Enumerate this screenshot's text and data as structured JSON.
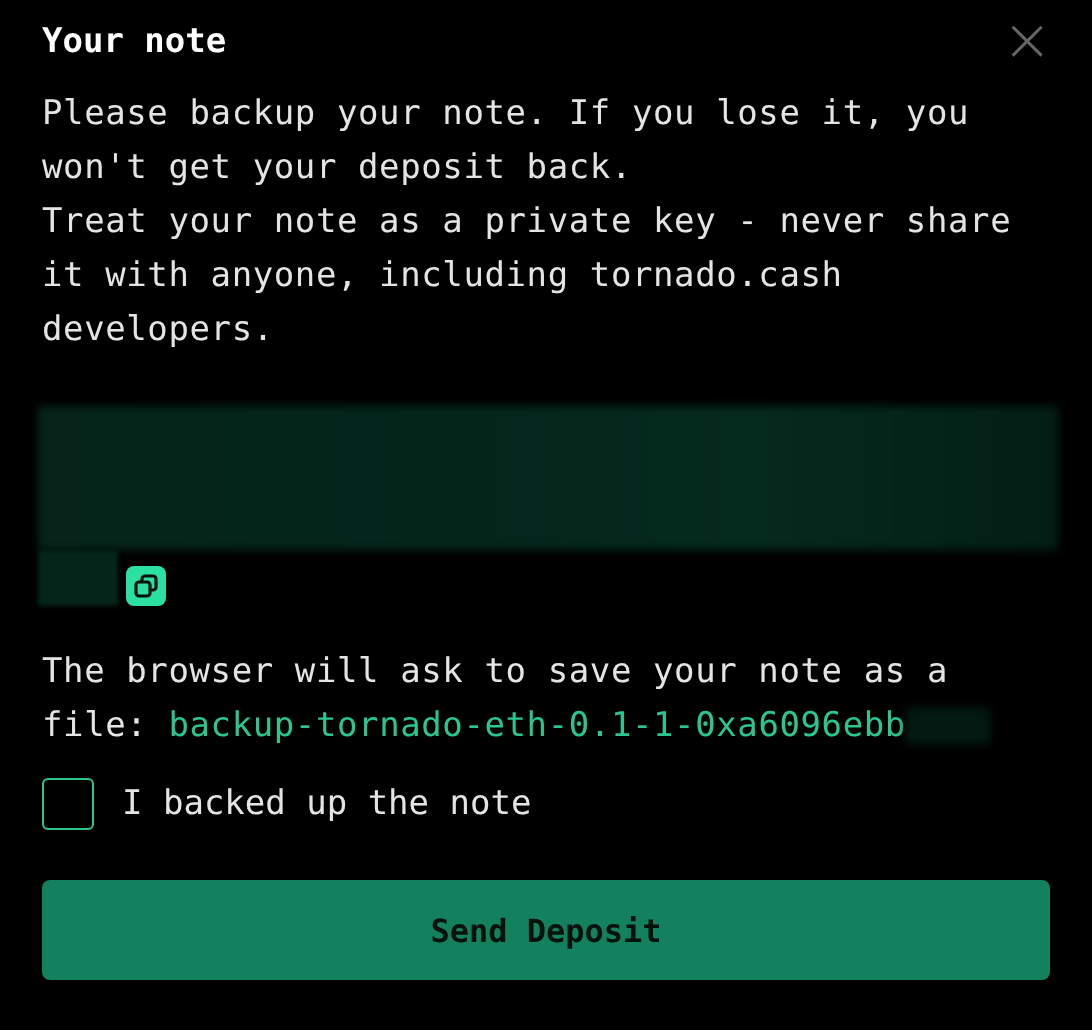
{
  "modal": {
    "title": "Your note",
    "close": "×"
  },
  "message": [
    "Please backup your note. If you lose it, you won't get your deposit back.",
    "Treat your note as a private key - never share it with anyone, including tornado.cash developers."
  ],
  "file_notice": {
    "text": "The browser will ask to save your note as a file:",
    "filename": "backup-tornado-eth-0.1-1-0xa6096ebb"
  },
  "checkbox": {
    "label": "I backed up the note",
    "checked": false
  },
  "button": {
    "label": "Send Deposit"
  }
}
